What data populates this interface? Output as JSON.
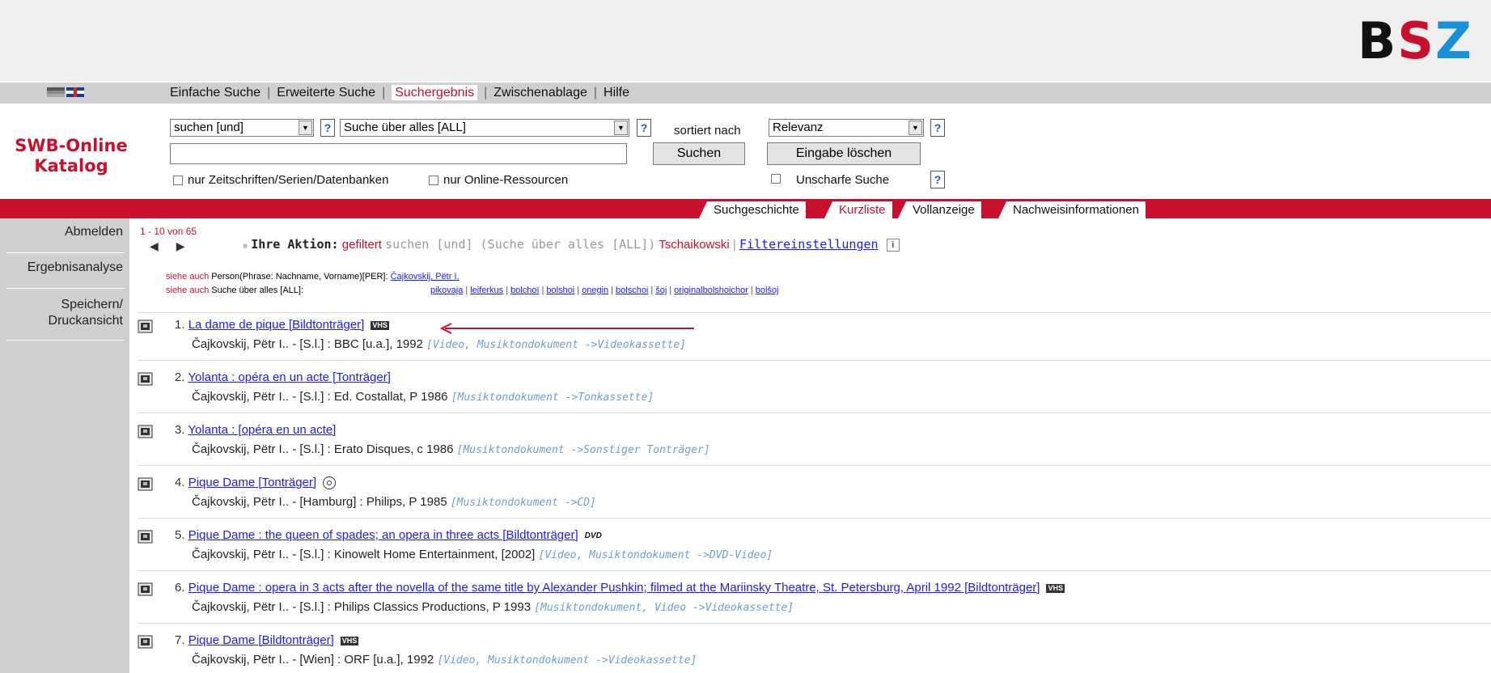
{
  "logo": {
    "b": "B",
    "s": "S",
    "z": "Z"
  },
  "nav": {
    "items": [
      "Einfache Suche",
      "Erweiterte Suche",
      "Suchergebnis",
      "Zwischenablage",
      "Hilfe"
    ],
    "active_index": 2
  },
  "catalog": {
    "line1": "SWB-Online",
    "line2": "Katalog"
  },
  "search": {
    "operator_select": "suchen [und]",
    "field_select": "Suche über alles [ALL]",
    "sort_label": "sortiert nach",
    "sort_select": "Relevanz",
    "query_value": "",
    "search_button": "Suchen",
    "clear_button": "Eingabe löschen",
    "check_journals": "nur Zeitschriften/Serien/Datenbanken",
    "check_online": "nur Online-Ressourcen",
    "check_fuzzy": "Unscharfe Suche",
    "help": "?"
  },
  "tabs": [
    "Suchgeschichte",
    "Kurzliste",
    "Vollanzeige",
    "Nachweisinformationen"
  ],
  "active_tab": "Kurzliste",
  "sidebar": {
    "items": [
      "Abmelden",
      "Ergebnisanalyse",
      "Speichern/",
      "Druckansicht"
    ]
  },
  "results": {
    "paging": "1 - 10 von 65",
    "prev": "◀",
    "next": "▶",
    "action_label": "Ihre Aktion:",
    "action_verb": "gefiltert",
    "action_query": "suchen [und] (Suche über alles [ALL])",
    "action_term": "Tschaikowski",
    "filter_link": "Filtereinstellungen",
    "info": "i",
    "seealso_1_label": "siehe auch",
    "seealso_1_index": "Person(Phrase: Nachname, Vorname)[PER]:",
    "seealso_1_link": "Čajkovskij, Pëtr I.",
    "seealso_2_label": "siehe auch",
    "seealso_2_index": "Suche über alles [ALL]:",
    "related_terms": [
      "pikovaja",
      "leiferkus",
      "bolchoï",
      "bolshoi",
      "onegin",
      "bolschoi",
      "šoj",
      "originalbolshoichor",
      "bolšoj"
    ],
    "records": [
      {
        "num": "1.",
        "title": "La dame de pique [Bildtonträger]",
        "badge": "VHS",
        "meta": "Čajkovskij, Pëtr I.. - [S.l.] : BBC [u.a.], 1992",
        "type": "[Video, Musiktondokument ->Videokassette]"
      },
      {
        "num": "2.",
        "title": "Yolanta : opéra en un acte [Tonträger]",
        "badge": "",
        "meta": "Čajkovskij, Pëtr I.. - [S.l.] : Ed. Costallat, P 1986",
        "type": "[Musiktondokument ->Tonkassette]"
      },
      {
        "num": "3.",
        "title": "Yolanta : [opéra en un acte]",
        "badge": "",
        "meta": "Čajkovskij, Pëtr I.. - [S.l.] : Erato Disques, c 1986",
        "type": "[Musiktondokument ->Sonstiger Tonträger]"
      },
      {
        "num": "4.",
        "title": "Pique Dame [Tonträger]",
        "badge": "CD",
        "meta": "Čajkovskij, Pëtr I.. - [Hamburg] : Philips, P 1985",
        "type": "[Musiktondokument ->CD]"
      },
      {
        "num": "5.",
        "title": "Pique Dame : the queen of spades; an opera in three acts [Bildtonträger]",
        "badge": "DVD",
        "meta": "Čajkovskij, Pëtr I.. - [S.l.] : Kinowelt Home Entertainment, [2002]",
        "type": "[Video, Musiktondokument ->DVD-Video]"
      },
      {
        "num": "6.",
        "title": "Pique Dame : opera in 3 acts after the novella of the same title by Alexander Pushkin; filmed at the Mariinsky Theatre, St. Petersburg, April 1992 [Bildtonträger]",
        "badge": "VHS",
        "meta": "Čajkovskij, Pëtr I.. - [S.l.] : Philips Classics Productions, P 1993",
        "type": "[Musiktondokument, Video ->Videokassette]"
      },
      {
        "num": "7.",
        "title": "Pique Dame [Bildtonträger]",
        "badge": "VHS",
        "meta": "Čajkovskij, Pëtr I.. - [Wien] : ORF [u.a.], 1992",
        "type": "[Video, Musiktondokument ->Videokassette]"
      }
    ]
  },
  "colors": {
    "brand_red": "#c8102e",
    "link_blue": "#1a1aff",
    "type_blue": "#6a9fd0",
    "nav_gray": "#cfcfcf"
  },
  "icons": [
    "flag-de-icon",
    "flag-uk-icon",
    "help-icon",
    "info-icon",
    "record-type-icon",
    "vhs-icon",
    "cd-icon",
    "dvd-icon",
    "red-arrow-icon"
  ]
}
